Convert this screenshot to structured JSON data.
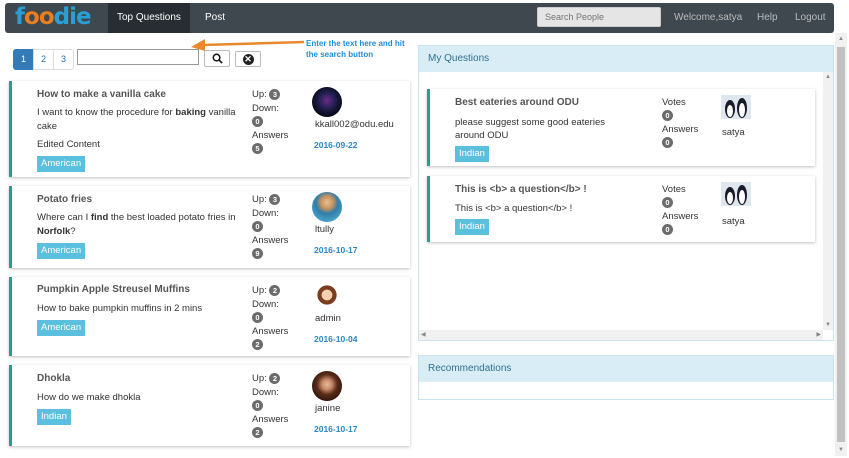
{
  "nav": {
    "logo_f": "f",
    "logo_oo": "oo",
    "logo_die": "die",
    "tabs": [
      "Top Questions",
      "Post"
    ],
    "search_placeholder": "Search People",
    "welcome": "Welcome,satya",
    "help": "Help",
    "logout": "Logout"
  },
  "pagination": [
    "1",
    "2",
    "3"
  ],
  "hint": "Enter the text here and hit the search button",
  "questions": [
    {
      "title": "How to make a vanilla cake",
      "body_parts": [
        "I want to know the procedure for ",
        "baking",
        " vanilla cake"
      ],
      "edited": "Edited Content",
      "tag": "American",
      "up_label": "Up:",
      "up": "3",
      "down_label": "Down:",
      "down": "0",
      "answers_label": "Answers",
      "answers": "5",
      "user": "kkall002@odu.edu",
      "date": "2016-09-22"
    },
    {
      "title": "Potato fries",
      "body_parts": [
        "Where can I ",
        "find",
        " the best loaded potato fries in ",
        "Norfolk",
        "?"
      ],
      "tag": "American",
      "up_label": "Up:",
      "up": "3",
      "down_label": "Down:",
      "down": "0",
      "answers_label": "Answers",
      "answers": "9",
      "user": "ltully",
      "date": "2016-10-17"
    },
    {
      "title": "Pumpkin Apple Streusel Muffins",
      "body": "How to bake pumpkin muffins in 2 mins",
      "tag": "American",
      "up_label": "Up:",
      "up": "2",
      "down_label": "Down:",
      "down": "0",
      "answers_label": "Answers",
      "answers": "2",
      "user": "admin",
      "date": "2016-10-04"
    },
    {
      "title": "Dhokla",
      "body": "How do we make dhokla",
      "tag": "Indian",
      "up_label": "Up:",
      "up": "2",
      "down_label": "Down:",
      "down": "0",
      "answers_label": "Answers",
      "answers": "2",
      "user": "janine",
      "date": "2016-10-17"
    }
  ],
  "my_questions": {
    "heading": "My Questions",
    "items": [
      {
        "title": "Best eateries around ODU",
        "body": "please suggest some good eateries around ODU",
        "tag": "Indian",
        "votes_label": "Votes",
        "votes": "0",
        "answers_label": "Answers",
        "answers": "0",
        "user": "satya"
      },
      {
        "title": "This is <b> a question</b> !",
        "body": "This is <b> a question</b> !",
        "tag": "Indian",
        "votes_label": "Votes",
        "votes": "0",
        "answers_label": "Answers",
        "answers": "0",
        "user": "satya"
      }
    ]
  },
  "recommendations": {
    "heading": "Recommendations"
  },
  "colors": {
    "navbar": "#3f474f",
    "accent": "#26a08a",
    "tag": "#5bc0de",
    "link": "#2a86c6",
    "panel_head": "#d9edf7"
  }
}
